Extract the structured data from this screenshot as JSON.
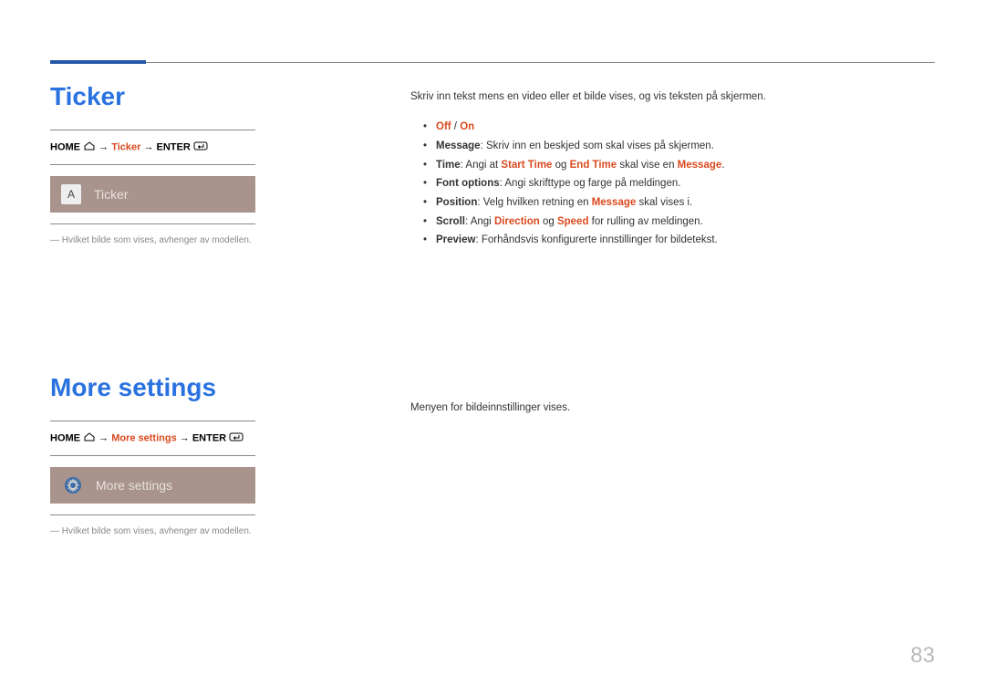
{
  "section1": {
    "title": "Ticker",
    "nav": {
      "home": "HOME",
      "arrow1": " → ",
      "item": "Ticker",
      "arrow2": " → ",
      "enter": "ENTER"
    },
    "tile": {
      "iconLetter": "A",
      "label": "Ticker"
    },
    "note": "― Hvilket bilde som vises, avhenger av modellen."
  },
  "section2": {
    "title": "More settings",
    "nav": {
      "home": "HOME",
      "arrow1": " → ",
      "item": "More settings",
      "arrow2": " → ",
      "enter": "ENTER"
    },
    "tile": {
      "label": "More settings"
    },
    "note": "― Hvilket bilde som vises, avhenger av modellen."
  },
  "right1": {
    "intro": "Skriv inn tekst mens en video eller et bilde vises, og vis teksten på skjermen.",
    "bullets": [
      {
        "parts": [
          {
            "t": "Off",
            "c": "highlight"
          },
          {
            "t": " / ",
            "c": ""
          },
          {
            "t": "On",
            "c": "highlight"
          }
        ]
      },
      {
        "parts": [
          {
            "t": "Message",
            "c": "bold"
          },
          {
            "t": ": Skriv inn en beskjed som skal vises på skjermen.",
            "c": ""
          }
        ]
      },
      {
        "parts": [
          {
            "t": "Time",
            "c": "bold"
          },
          {
            "t": ": Angi at ",
            "c": ""
          },
          {
            "t": "Start Time",
            "c": "highlight"
          },
          {
            "t": " og ",
            "c": ""
          },
          {
            "t": "End Time",
            "c": "highlight"
          },
          {
            "t": " skal vise en ",
            "c": ""
          },
          {
            "t": "Message",
            "c": "highlight"
          },
          {
            "t": ".",
            "c": ""
          }
        ]
      },
      {
        "parts": [
          {
            "t": "Font options",
            "c": "bold"
          },
          {
            "t": ": Angi skrifttype og farge på meldingen.",
            "c": ""
          }
        ]
      },
      {
        "parts": [
          {
            "t": "Position",
            "c": "bold"
          },
          {
            "t": ": Velg hvilken retning en ",
            "c": ""
          },
          {
            "t": "Message",
            "c": "highlight"
          },
          {
            "t": " skal vises i.",
            "c": ""
          }
        ]
      },
      {
        "parts": [
          {
            "t": "Scroll",
            "c": "bold"
          },
          {
            "t": ": Angi ",
            "c": ""
          },
          {
            "t": "Direction",
            "c": "highlight"
          },
          {
            "t": " og ",
            "c": ""
          },
          {
            "t": "Speed",
            "c": "highlight"
          },
          {
            "t": " for rulling av meldingen.",
            "c": ""
          }
        ]
      },
      {
        "parts": [
          {
            "t": "Preview",
            "c": "bold"
          },
          {
            "t": ": Forhåndsvis konfigurerte innstillinger for bildetekst.",
            "c": ""
          }
        ]
      }
    ]
  },
  "right2": {
    "intro": "Menyen for bildeinnstillinger vises."
  },
  "pageNumber": "83"
}
